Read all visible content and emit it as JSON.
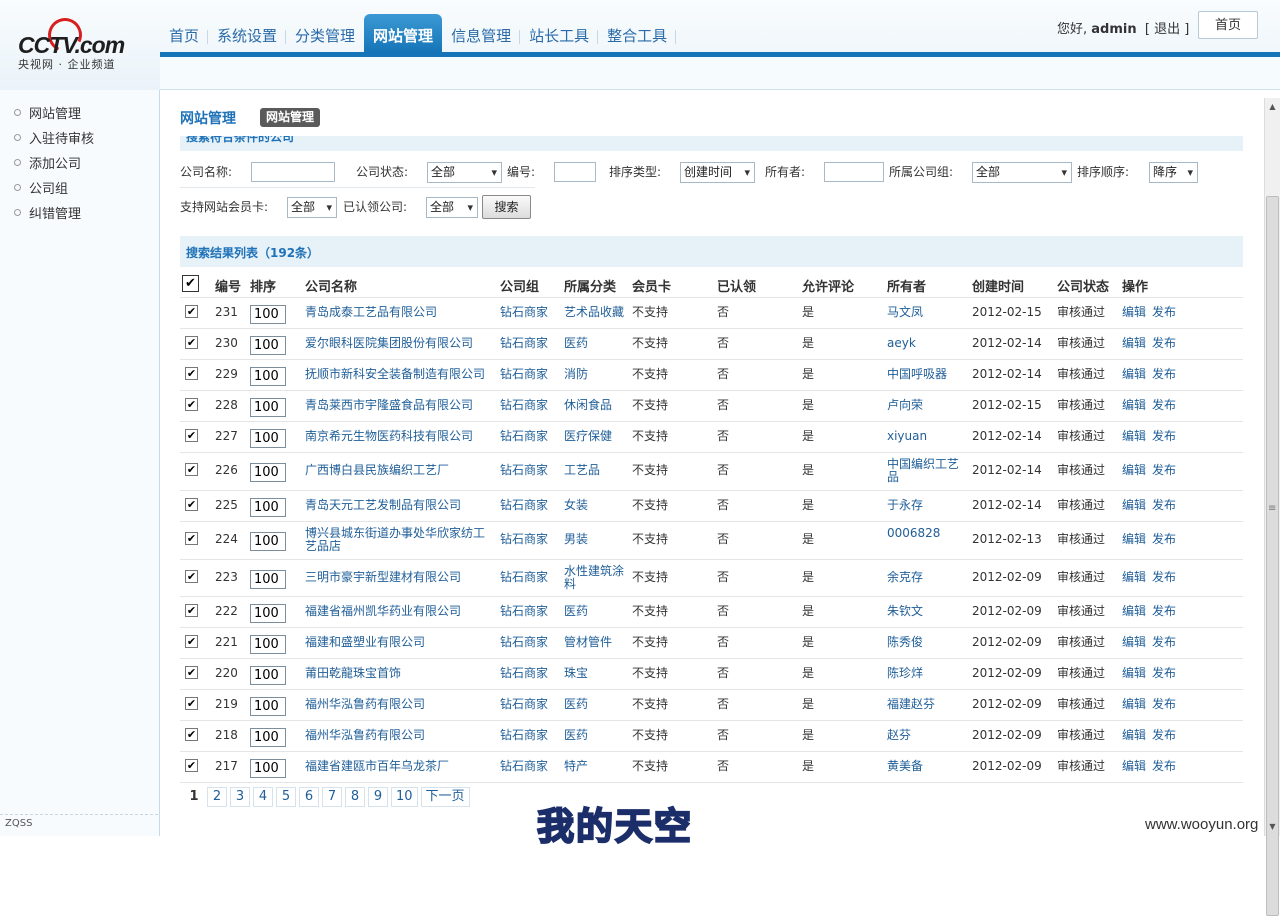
{
  "header": {
    "logo_text": "CCTV.com",
    "logo_sub": "央视网 · 企业频道",
    "nav_tabs": [
      {
        "label": "首页"
      },
      {
        "label": "系统设置"
      },
      {
        "label": "分类管理"
      },
      {
        "label": "网站管理",
        "active": true
      },
      {
        "label": "信息管理"
      },
      {
        "label": "站长工具"
      },
      {
        "label": "整合工具"
      }
    ],
    "greeting": "您好,",
    "username": "admin",
    "logout": "[ 退出 ]",
    "home_button": "首页"
  },
  "sidebar": {
    "items": [
      "网站管理",
      "入驻待审核",
      "添加公司",
      "公司组",
      "纠错管理"
    ],
    "footer": "ZQSS"
  },
  "page": {
    "title": "网站管理",
    "badge": "网站管理",
    "search_section": "搜索符合条件的公司"
  },
  "filters": {
    "company_name_label": "公司名称:",
    "company_status_label": "公司状态:",
    "company_status_value": "全部",
    "number_label": "编号:",
    "sort_type_label": "排序类型:",
    "sort_type_value": "创建时间",
    "owner_label": "所有者:",
    "group_label": "所属公司组:",
    "group_value": "全部",
    "sort_order_label": "排序顺序:",
    "sort_order_value": "降序",
    "member_card_label": "支持网站会员卡:",
    "member_card_value": "全部",
    "claimed_label": "已认领公司:",
    "claimed_value": "全部",
    "search_button": "搜索"
  },
  "results": {
    "title": "搜索结果列表（192条）",
    "columns": [
      "编号",
      "排序",
      "公司名称",
      "公司组",
      "所属分类",
      "会员卡",
      "已认领",
      "允许评论",
      "所有者",
      "创建时间",
      "公司状态",
      "操作"
    ],
    "action_edit": "编辑",
    "action_publish": "发布",
    "rows": [
      {
        "id": "231",
        "sort": "100",
        "name": "青岛成泰工艺品有限公司",
        "group": "钻石商家",
        "category": "艺术品收藏",
        "card": "不支持",
        "claimed": "否",
        "comment": "是",
        "owner": "马文凤",
        "created": "2012-02-15",
        "status": "审核通过"
      },
      {
        "id": "230",
        "sort": "100",
        "name": "爱尔眼科医院集团股份有限公司",
        "group": "钻石商家",
        "category": "医药",
        "card": "不支持",
        "claimed": "否",
        "comment": "是",
        "owner": "aeyk",
        "created": "2012-02-14",
        "status": "审核通过"
      },
      {
        "id": "229",
        "sort": "100",
        "name": "抚顺市新科安全装备制造有限公司",
        "group": "钻石商家",
        "category": "消防",
        "card": "不支持",
        "claimed": "否",
        "comment": "是",
        "owner": "中国呼吸器",
        "created": "2012-02-14",
        "status": "审核通过"
      },
      {
        "id": "228",
        "sort": "100",
        "name": "青岛莱西市宇隆盛食品有限公司",
        "group": "钻石商家",
        "category": "休闲食品",
        "card": "不支持",
        "claimed": "否",
        "comment": "是",
        "owner": "卢向荣",
        "created": "2012-02-15",
        "status": "审核通过"
      },
      {
        "id": "227",
        "sort": "100",
        "name": "南京希元生物医药科技有限公司",
        "group": "钻石商家",
        "category": "医疗保健",
        "card": "不支持",
        "claimed": "否",
        "comment": "是",
        "owner": "xiyuan",
        "created": "2012-02-14",
        "status": "审核通过"
      },
      {
        "id": "226",
        "sort": "100",
        "name": "广西博白县民族编织工艺厂",
        "group": "钻石商家",
        "category": "工艺品",
        "card": "不支持",
        "claimed": "否",
        "comment": "是",
        "owner": "中国编织工艺品",
        "created": "2012-02-14",
        "status": "审核通过"
      },
      {
        "id": "225",
        "sort": "100",
        "name": "青岛天元工艺发制品有限公司",
        "group": "钻石商家",
        "category": "女装",
        "card": "不支持",
        "claimed": "否",
        "comment": "是",
        "owner": "于永存",
        "created": "2012-02-14",
        "status": "审核通过"
      },
      {
        "id": "224",
        "sort": "100",
        "name": "博兴县城东街道办事处华欣家纺工艺品店",
        "group": "钻石商家",
        "category": "男装",
        "card": "不支持",
        "claimed": "否",
        "comment": "是",
        "owner": "0006828",
        "created": "2012-02-13",
        "status": "审核通过"
      },
      {
        "id": "223",
        "sort": "100",
        "name": "三明市豪宇新型建材有限公司",
        "group": "钻石商家",
        "category": "水性建筑涂料",
        "card": "不支持",
        "claimed": "否",
        "comment": "是",
        "owner": "余克存",
        "created": "2012-02-09",
        "status": "审核通过"
      },
      {
        "id": "222",
        "sort": "100",
        "name": "福建省福州凯华药业有限公司",
        "group": "钻石商家",
        "category": "医药",
        "card": "不支持",
        "claimed": "否",
        "comment": "是",
        "owner": "朱钦文",
        "created": "2012-02-09",
        "status": "审核通过"
      },
      {
        "id": "221",
        "sort": "100",
        "name": "福建和盛塑业有限公司",
        "group": "钻石商家",
        "category": "管材管件",
        "card": "不支持",
        "claimed": "否",
        "comment": "是",
        "owner": "陈秀俊",
        "created": "2012-02-09",
        "status": "审核通过"
      },
      {
        "id": "220",
        "sort": "100",
        "name": "莆田乾龍珠宝首饰",
        "group": "钻石商家",
        "category": "珠宝",
        "card": "不支持",
        "claimed": "否",
        "comment": "是",
        "owner": "陈珍烊",
        "created": "2012-02-09",
        "status": "审核通过"
      },
      {
        "id": "219",
        "sort": "100",
        "name": "福州华泓鲁药有限公司",
        "group": "钻石商家",
        "category": "医药",
        "card": "不支持",
        "claimed": "否",
        "comment": "是",
        "owner": "福建赵芬",
        "created": "2012-02-09",
        "status": "审核通过"
      },
      {
        "id": "218",
        "sort": "100",
        "name": "福州华泓鲁药有限公司",
        "group": "钻石商家",
        "category": "医药",
        "card": "不支持",
        "claimed": "否",
        "comment": "是",
        "owner": "赵芬",
        "created": "2012-02-09",
        "status": "审核通过"
      },
      {
        "id": "217",
        "sort": "100",
        "name": "福建省建瓯市百年乌龙茶厂",
        "group": "钻石商家",
        "category": "特产",
        "card": "不支持",
        "claimed": "否",
        "comment": "是",
        "owner": "黄美备",
        "created": "2012-02-09",
        "status": "审核通过"
      }
    ]
  },
  "pager": {
    "pages": [
      "1",
      "2",
      "3",
      "4",
      "5",
      "6",
      "7",
      "8",
      "9",
      "10"
    ],
    "next": "下一页",
    "current": "1"
  },
  "watermark": {
    "text": "我的天空",
    "site": "www.wooyun.org"
  },
  "colors": {
    "accent": "#1675b8",
    "link": "#1f5e98",
    "header_bg": "#e6f1f8"
  }
}
